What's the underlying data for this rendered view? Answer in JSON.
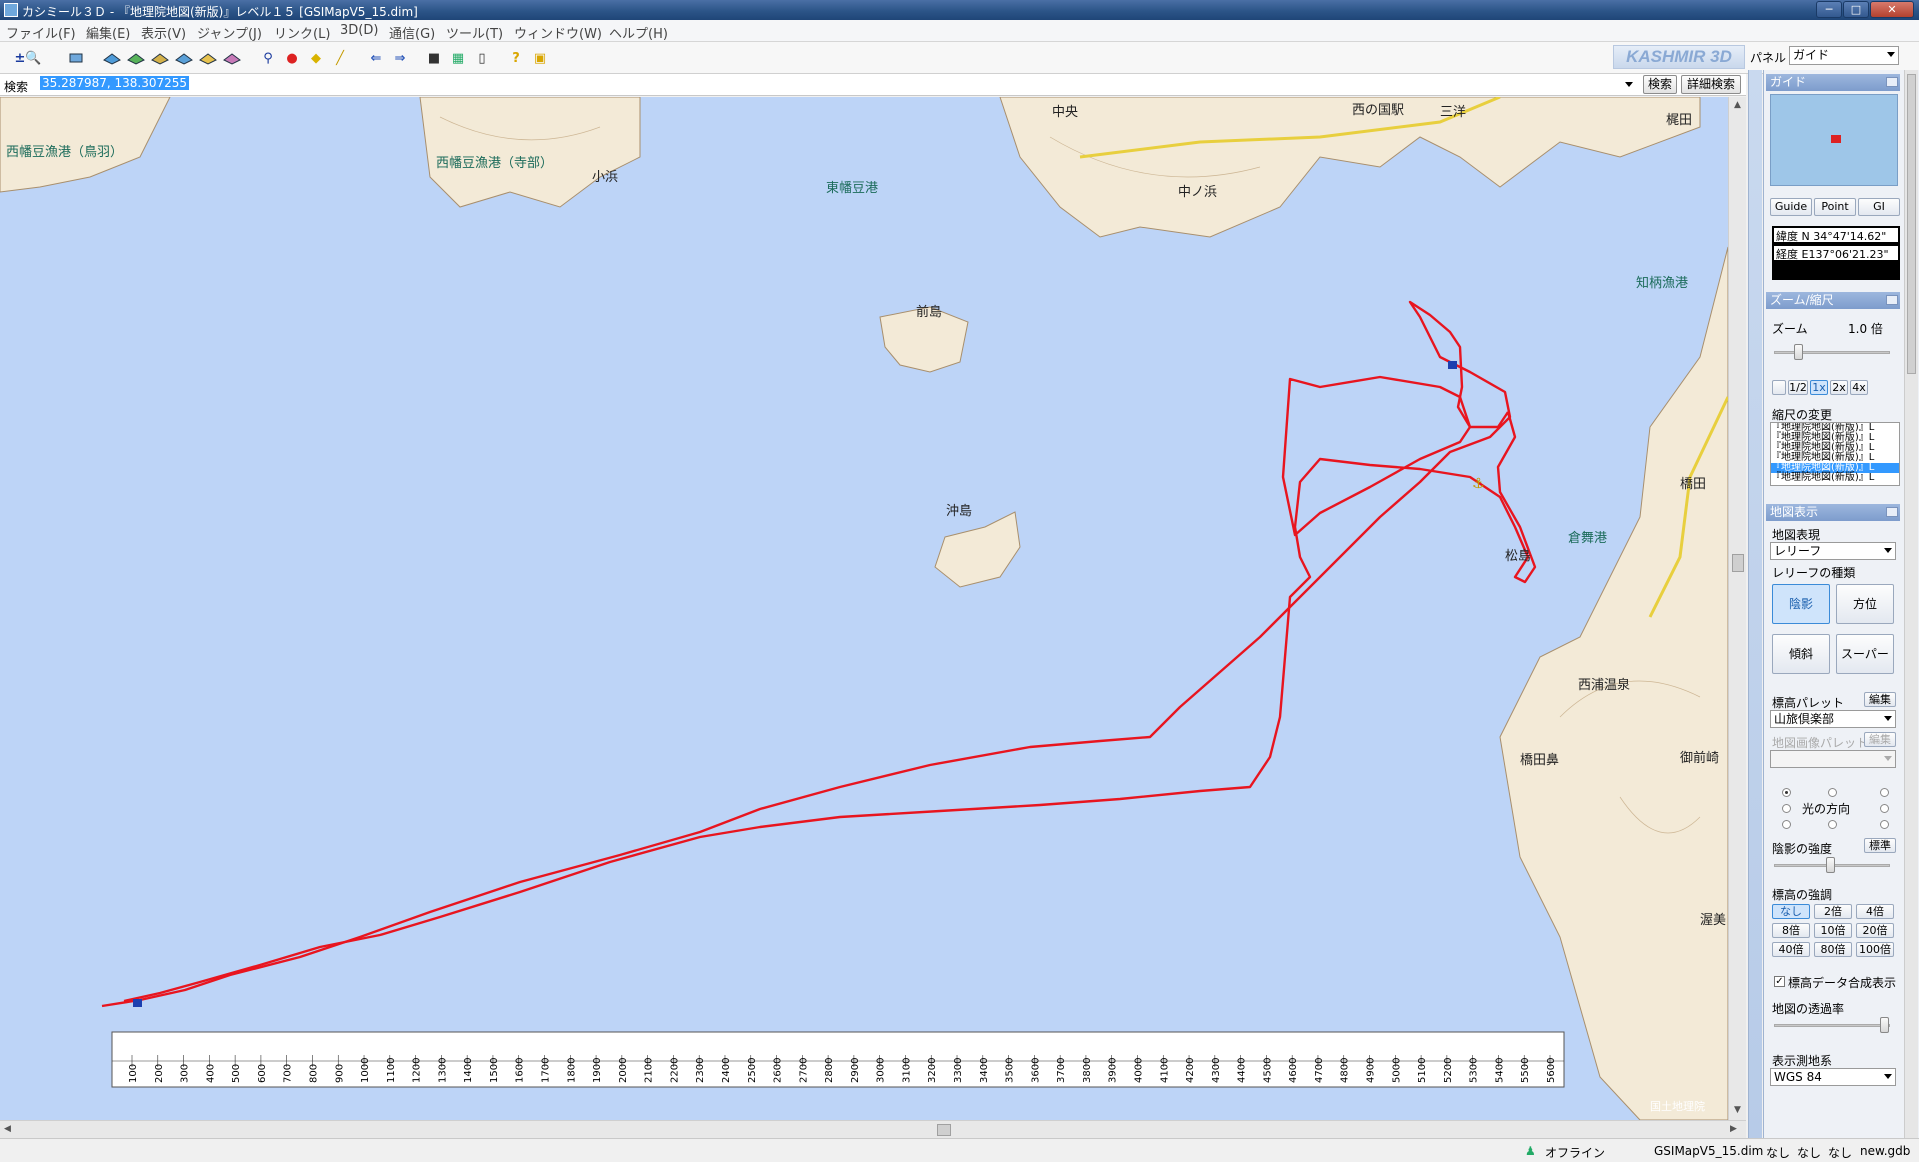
{
  "window": {
    "title": "カシミール３Ｄ - 『地理院地図(新版)』レベル１５ [GSIMapV5_15.dim]",
    "buttons": [
      "─",
      "□",
      "✕"
    ]
  },
  "menu": [
    "ファイル(F)",
    "編集(E)",
    "表示(V)",
    "ジャンプ(J)",
    "リンク(L)",
    "3D(D)",
    "通信(G)",
    "ツール(T)",
    "ウィンドウ(W)",
    "ヘルプ(H)"
  ],
  "toolbar": {
    "icons": [
      "zoom-tool-icon",
      "layer-icon",
      "map-layer-1-icon",
      "map-layer-2-icon",
      "map-layer-3-icon",
      "map-layer-4-icon",
      "map-layer-5-icon",
      "map-layer-6-icon",
      "binoculars-icon",
      "marker-icon",
      "tag-icon",
      "ruler-icon",
      "back-icon",
      "forward-icon",
      "camera-icon",
      "map-view-icon",
      "gps-device-icon",
      "help-icon",
      "info-icon"
    ],
    "logo": "KASHMIR 3D",
    "panel_label": "パネル",
    "panel_value": "ガイド"
  },
  "search": {
    "label": "検索",
    "value": "35.287987, 138.307255",
    "search_button": "検索",
    "detail_button": "詳細検索"
  },
  "map": {
    "labels": [
      {
        "text": "西幡豆漁港（鳥羽）",
        "kind": "harbor"
      },
      {
        "text": "西幡豆漁港（寺部）",
        "kind": "harbor"
      },
      {
        "text": "小浜",
        "kind": "place"
      },
      {
        "text": "東幡豆港",
        "kind": "harbor"
      },
      {
        "text": "中ノ浜",
        "kind": "place"
      },
      {
        "text": "前島",
        "kind": "island"
      },
      {
        "text": "沖島",
        "kind": "island"
      },
      {
        "text": "知柄漁港",
        "kind": "harbor"
      },
      {
        "text": "倉舞港",
        "kind": "harbor"
      },
      {
        "text": "松島",
        "kind": "island"
      },
      {
        "text": "西浦温泉",
        "kind": "place"
      },
      {
        "text": "橋田鼻",
        "kind": "place"
      },
      {
        "text": "御前崎",
        "kind": "place"
      },
      {
        "text": "梶田",
        "kind": "place"
      },
      {
        "text": "橋田",
        "kind": "place"
      },
      {
        "text": "渥美",
        "kind": "place"
      },
      {
        "text": "中央",
        "kind": "place"
      },
      {
        "text": "西の国駅",
        "kind": "place"
      },
      {
        "text": "三洋",
        "kind": "place"
      }
    ],
    "attribution": "国土地理院",
    "profile_ruler_ticks": [
      "100",
      "200",
      "300",
      "400",
      "500",
      "600",
      "700",
      "800",
      "900",
      "1000",
      "1100",
      "1200",
      "1300",
      "1400",
      "1500",
      "1600",
      "1700",
      "1800",
      "1900",
      "2000",
      "2100",
      "2200",
      "2300",
      "2400",
      "2500",
      "2600",
      "2700",
      "2800",
      "2900",
      "3000",
      "3100",
      "3200",
      "3300",
      "3400",
      "3500",
      "3600",
      "3700",
      "3800",
      "3900",
      "4000",
      "4100",
      "4200",
      "4300",
      "4400",
      "4500",
      "4600",
      "4700",
      "4800",
      "4900",
      "5000",
      "5100",
      "5200",
      "5300",
      "5400",
      "5500",
      "5600"
    ],
    "track_color": "#e8151f"
  },
  "panel": {
    "guide": {
      "header": "ガイド",
      "tabs": [
        "Guide",
        "Point",
        "GI"
      ],
      "lat_label": "緯度",
      "lat_value": "N 34°47'14.62\"",
      "lon_label": "経度",
      "lon_value": "E137°06'21.23\""
    },
    "zoom": {
      "header": "ズーム/縮尺",
      "zoom_label": "ズーム",
      "zoom_value": "1.0 倍",
      "zoom_buttons": [
        "1/2",
        "1x",
        "2x",
        "4x"
      ],
      "scale_label": "縮尺の変更",
      "scale_list": [
        "『地理院地図(新版)』L",
        "『地理院地図(新版)』L",
        "『地理院地図(新版)』L",
        "『地理院地図(新版)』L",
        "『地理院地図(新版)』L",
        "『地理院地図(新版)』L"
      ]
    },
    "map_display": {
      "header": "地図表示",
      "style_label": "地図表現",
      "style_value": "レリーフ",
      "relief_label": "レリーフの種類",
      "relief_buttons": [
        "陰影",
        "方位",
        "傾斜",
        "スーパー"
      ],
      "palette_label": "標高パレット",
      "palette_edit": "編集",
      "palette_value": "山旅倶楽部",
      "image_palette_label": "地図画像パレット",
      "image_palette_edit": "編集",
      "light_label": "光の方向",
      "shade_label": "陰影の強度",
      "shade_button": "標準",
      "emphasis_label": "標高の強調",
      "emphasis_buttons": [
        "なし",
        "2倍",
        "4倍",
        "8倍",
        "10倍",
        "20倍",
        "40倍",
        "80倍",
        "100倍"
      ],
      "composite_label": "標高データ合成表示",
      "opacity_label": "地図の透過率",
      "datum_label": "表示測地系",
      "datum_value": "WGS 84"
    }
  },
  "status": {
    "offline": "オフライン",
    "file": "GSIMapV5_15.dim",
    "fields": [
      "なし",
      "なし",
      "なし"
    ],
    "gdb": "new.gdb"
  }
}
